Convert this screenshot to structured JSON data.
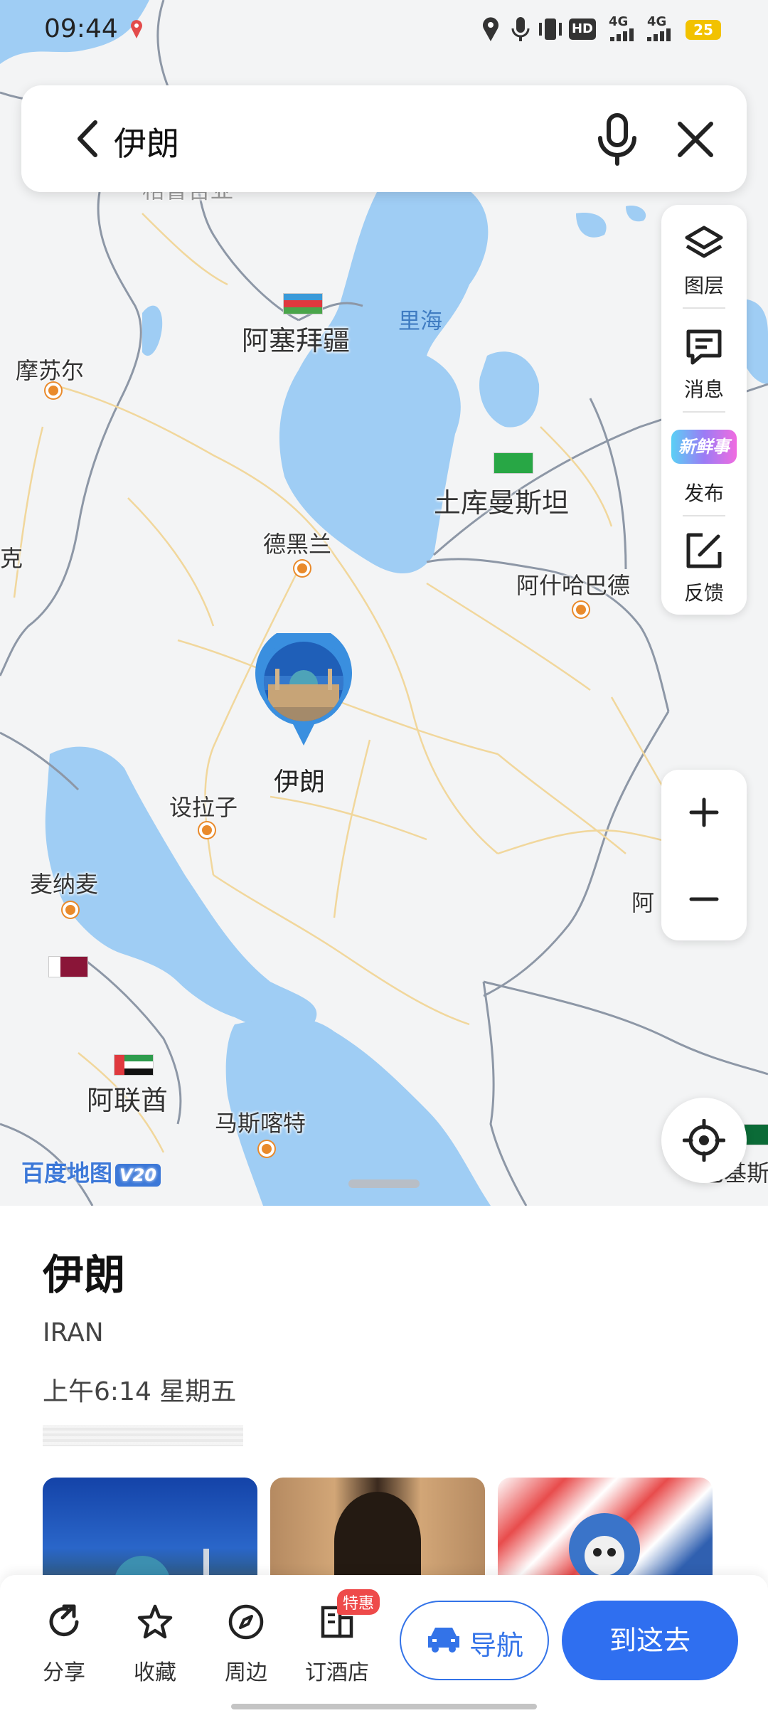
{
  "status_bar": {
    "time": "09:44",
    "battery": "25",
    "network_1": "4G",
    "network_2": "4G",
    "hd": "HD"
  },
  "search": {
    "query": "伊朗"
  },
  "toolbar": {
    "items": [
      {
        "label": "图层",
        "icon": "layers-icon"
      },
      {
        "label": "消息",
        "icon": "message-icon"
      },
      {
        "label": "发布",
        "icon": "new-post-icon",
        "badge_text": "新鲜事"
      },
      {
        "label": "反馈",
        "icon": "feedback-icon"
      }
    ]
  },
  "map": {
    "labels": {
      "azerbaijan": "阿塞拜疆",
      "caspian_sea": "里海",
      "mosul": "摩苏尔",
      "turkmenistan": "土库曼斯坦",
      "tehran": "德黑兰",
      "ashgabat": "阿什哈巴德",
      "partial_left": "克",
      "shiraz": "设拉子",
      "manama": "麦纳麦",
      "uae": "阿联酋",
      "muscat": "马斯喀特",
      "partial_right": "阿",
      "partial_bottom_right": "巴基斯",
      "top_cut": "格鲁吉亚"
    },
    "marker_label": "伊朗",
    "logo_text": "百度地图",
    "logo_version": "V20",
    "colors": {
      "water": "#9fcdf4",
      "land": "#f3f4f5",
      "border": "#8d97a6",
      "road": "#f1d79c"
    }
  },
  "place": {
    "name": "伊朗",
    "english_name": "IRAN",
    "local_time": "上午6:14 星期五"
  },
  "bottom_bar": {
    "share": "分享",
    "favorite": "收藏",
    "nearby": "周边",
    "hotel": "订酒店",
    "hotel_badge": "特惠",
    "navigate": "导航",
    "go_here": "到这去",
    "accent": "#2f6ff0"
  }
}
